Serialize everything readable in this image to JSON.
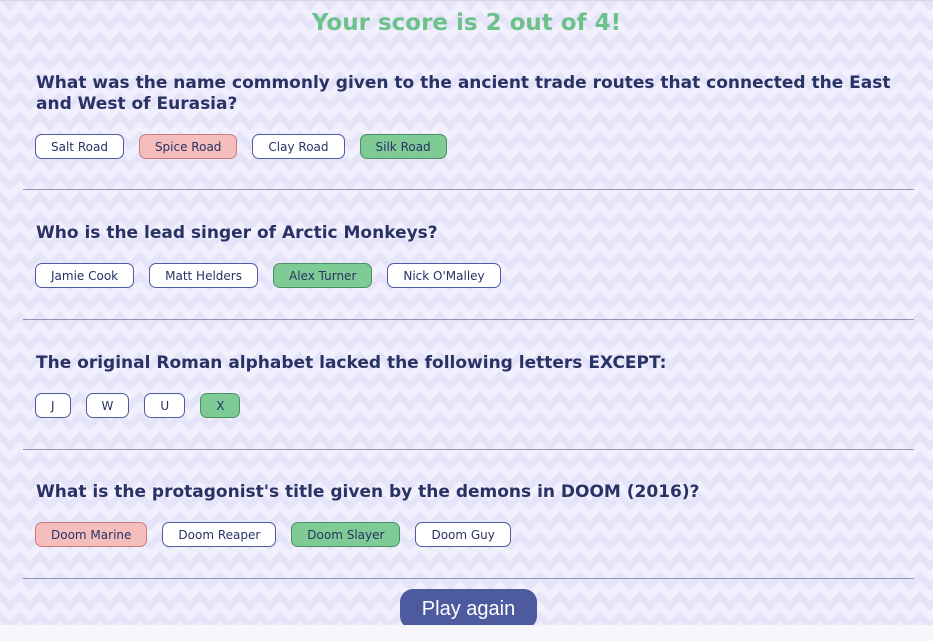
{
  "score": {
    "text": "Your score is 2 out of 4!"
  },
  "questions": [
    {
      "question": "What was the name commonly given to the ancient trade routes that connected the East and West of Eurasia?",
      "answers": [
        {
          "label": "Salt Road",
          "state": "neutral"
        },
        {
          "label": "Spice Road",
          "state": "wrong"
        },
        {
          "label": "Clay Road",
          "state": "neutral"
        },
        {
          "label": "Silk Road",
          "state": "correct"
        }
      ]
    },
    {
      "question": "Who is the lead singer of Arctic Monkeys?",
      "answers": [
        {
          "label": "Jamie Cook",
          "state": "neutral"
        },
        {
          "label": "Matt Helders",
          "state": "neutral"
        },
        {
          "label": "Alex Turner",
          "state": "correct"
        },
        {
          "label": "Nick O'Malley",
          "state": "neutral"
        }
      ]
    },
    {
      "question": "The original Roman alphabet lacked the following letters EXCEPT:",
      "answers": [
        {
          "label": "J",
          "state": "neutral"
        },
        {
          "label": "W",
          "state": "neutral"
        },
        {
          "label": "U",
          "state": "neutral"
        },
        {
          "label": "X",
          "state": "correct"
        }
      ]
    },
    {
      "question": "What is the protagonist's title given by the demons in DOOM (2016)?",
      "answers": [
        {
          "label": "Doom Marine",
          "state": "wrong"
        },
        {
          "label": "Doom Reaper",
          "state": "neutral"
        },
        {
          "label": "Doom Slayer",
          "state": "correct"
        },
        {
          "label": "Doom Guy",
          "state": "neutral"
        }
      ]
    }
  ],
  "play_again": {
    "label": "Play again"
  },
  "colors": {
    "correct": "#7fcb95",
    "wrong": "#f6bdbd",
    "accent": "#4d5b9e",
    "score": "#6cc28a",
    "text": "#293264"
  }
}
